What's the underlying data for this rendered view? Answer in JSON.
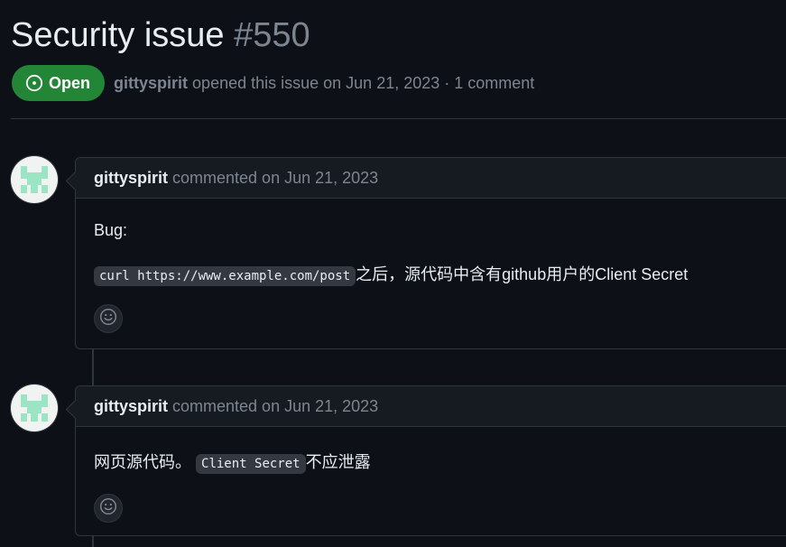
{
  "issue": {
    "title": "Security issue",
    "number": "#550",
    "state": "Open",
    "author": "gittyspirit",
    "meta": "opened this issue on Jun 21, 2023 · 1 comment"
  },
  "comments": [
    {
      "author": "gittyspirit",
      "date": "commented on Jun 21, 2023",
      "line1": "Bug:",
      "code": "curl https://www.example.com/post",
      "line2_suffix": "之后，源代码中含有github用户的Client Secret",
      "reaction_icon": "smiley-icon"
    },
    {
      "author": "gittyspirit",
      "date": "commented on Jun 21, 2023",
      "prefix": "网页源代码。",
      "code": "Client Secret",
      "suffix": "不应泄露",
      "reaction_icon": "smiley-icon"
    }
  ],
  "colors": {
    "background": "#0d1117",
    "open_badge": "#238636",
    "avatar_green": "#9be5c4",
    "border": "#30363d",
    "muted_text": "#7d8590"
  }
}
